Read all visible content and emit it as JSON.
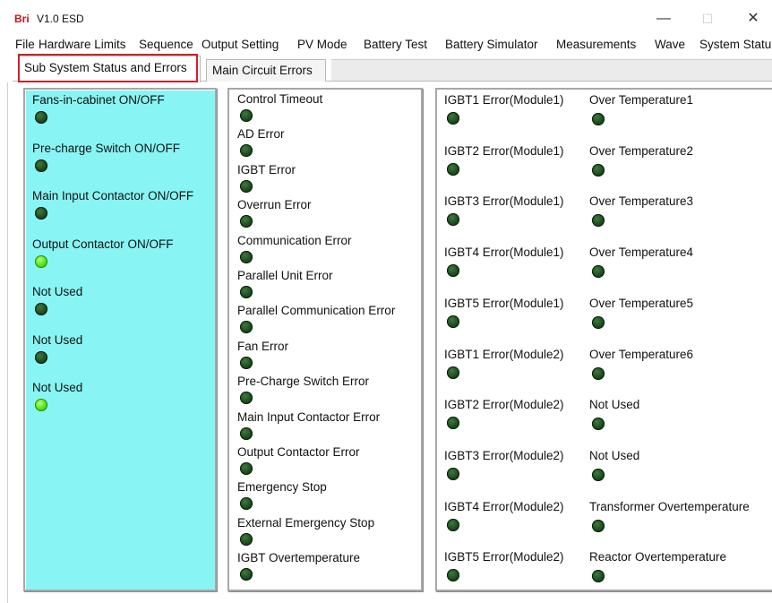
{
  "window": {
    "logo": "Bri",
    "title": "V1.0  ESD",
    "controls": {
      "minimize": "—",
      "maximize": "☐",
      "close": "✕"
    }
  },
  "menu": {
    "items": [
      "File",
      "Hardware Limits",
      "Sequence",
      "Output Setting",
      "PV Mode",
      "Battery Test",
      "Battery Simulator",
      "Measurements",
      "Wave",
      "System Statu"
    ]
  },
  "tabs": [
    {
      "label": "Sub System Status and Errors",
      "active": true
    },
    {
      "label": "Main Circuit Errors",
      "active": false
    }
  ],
  "colors": {
    "panel_cyan": "#88f4f4",
    "led_on": "#4fe01a",
    "led_off": "#1c4a1c",
    "highlight": "#d31f2b"
  },
  "subsystem": [
    {
      "label": "Fans-in-cabinet ON/OFF",
      "on": false
    },
    {
      "label": "Pre-charge Switch ON/OFF",
      "on": false
    },
    {
      "label": "Main Input Contactor ON/OFF",
      "on": false
    },
    {
      "label": "Output Contactor ON/OFF",
      "on": true
    },
    {
      "label": "Not Used",
      "on": false
    },
    {
      "label": "Not Used",
      "on": false
    },
    {
      "label": "Not Used",
      "on": true
    }
  ],
  "errors": [
    {
      "label": "Control Timeout",
      "on": false
    },
    {
      "label": "AD Error",
      "on": false
    },
    {
      "label": "IGBT Error",
      "on": false
    },
    {
      "label": "Overrun Error",
      "on": false
    },
    {
      "label": "Communication Error",
      "on": false
    },
    {
      "label": "Parallel Unit Error",
      "on": false
    },
    {
      "label": "Parallel Communication Error",
      "on": false
    },
    {
      "label": "Fan Error",
      "on": false
    },
    {
      "label": "Pre-Charge Switch Error",
      "on": false
    },
    {
      "label": "Main Input Contactor Error",
      "on": false
    },
    {
      "label": "Output Contactor Error",
      "on": false
    },
    {
      "label": "Emergency Stop",
      "on": false
    },
    {
      "label": "External Emergency Stop",
      "on": false
    },
    {
      "label": "IGBT Overtemperature",
      "on": false
    }
  ],
  "igbt": [
    {
      "label": "IGBT1 Error(Module1)",
      "on": false
    },
    {
      "label": "IGBT2 Error(Module1)",
      "on": false
    },
    {
      "label": "IGBT3 Error(Module1)",
      "on": false
    },
    {
      "label": "IGBT4 Error(Module1)",
      "on": false
    },
    {
      "label": "IGBT5 Error(Module1)",
      "on": false
    },
    {
      "label": "IGBT1 Error(Module2)",
      "on": false
    },
    {
      "label": "IGBT2 Error(Module2)",
      "on": false
    },
    {
      "label": "IGBT3 Error(Module2)",
      "on": false
    },
    {
      "label": "IGBT4 Error(Module2)",
      "on": false
    },
    {
      "label": "IGBT5 Error(Module2)",
      "on": false
    }
  ],
  "temps": [
    {
      "label": "Over Temperature1",
      "on": false
    },
    {
      "label": "Over Temperature2",
      "on": false
    },
    {
      "label": "Over Temperature3",
      "on": false
    },
    {
      "label": "Over Temperature4",
      "on": false
    },
    {
      "label": "Over Temperature5",
      "on": false
    },
    {
      "label": "Over Temperature6",
      "on": false
    },
    {
      "label": "Not Used",
      "on": false
    },
    {
      "label": "Not Used",
      "on": false
    },
    {
      "label": "Transformer Overtemperature",
      "on": false
    },
    {
      "label": "Reactor Overtemperature",
      "on": false
    }
  ]
}
